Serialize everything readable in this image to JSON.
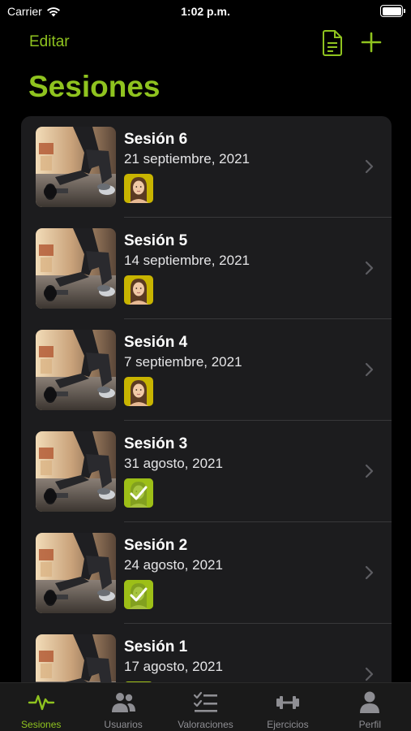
{
  "status_bar": {
    "carrier": "Carrier",
    "time": "1:02 p.m."
  },
  "nav": {
    "edit_label": "Editar",
    "title": "Sesiones"
  },
  "colors": {
    "accent": "#8fc31f",
    "background": "#000000",
    "card": "#1c1c1e"
  },
  "sessions": [
    {
      "name": "Sesión 6",
      "date": "21 septiembre, 2021",
      "completed": false
    },
    {
      "name": "Sesión 5",
      "date": "14 septiembre, 2021",
      "completed": false
    },
    {
      "name": "Sesión 4",
      "date": "7 septiembre, 2021",
      "completed": false
    },
    {
      "name": "Sesión 3",
      "date": "31 agosto, 2021",
      "completed": true
    },
    {
      "name": "Sesión 2",
      "date": "24 agosto, 2021",
      "completed": true
    },
    {
      "name": "Sesión 1",
      "date": "17 agosto, 2021",
      "completed": true
    }
  ],
  "tabs": [
    {
      "label": "Sesiones",
      "icon": "heartbeat-icon",
      "active": true
    },
    {
      "label": "Usuarios",
      "icon": "users-icon",
      "active": false
    },
    {
      "label": "Valoraciones",
      "icon": "checklist-icon",
      "active": false
    },
    {
      "label": "Ejercicios",
      "icon": "dumbbell-icon",
      "active": false
    },
    {
      "label": "Perfil",
      "icon": "person-icon",
      "active": false
    }
  ]
}
